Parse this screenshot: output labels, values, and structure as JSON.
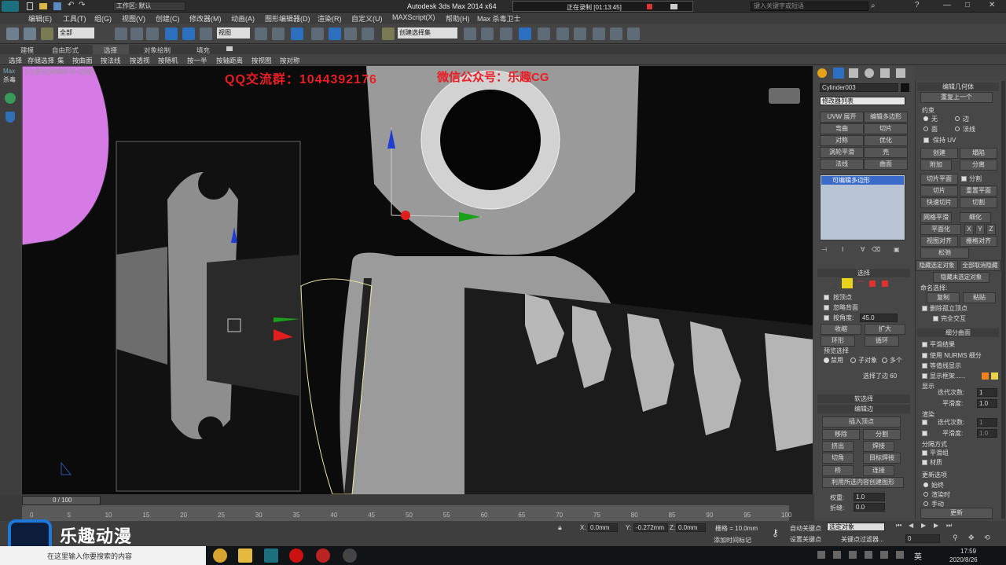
{
  "app": {
    "title": "Autodesk 3ds Max  2014 x64",
    "workspace": "工作区: 默认",
    "search_placeholder": "键入关键字或短语",
    "recording": "正在录制 [01:13:45]"
  },
  "menu": [
    "编辑(E)",
    "工具(T)",
    "组(G)",
    "视图(V)",
    "创建(C)",
    "修改器(M)",
    "动画(A)",
    "图形编辑器(D)",
    "渲染(R)",
    "自定义(U)",
    "MAXScript(X)",
    "帮助(H)",
    "Max 杀毒卫士"
  ],
  "toolbar": {
    "selection_filter": "全部",
    "view_dropdown": "视图",
    "named_set": "创建选择集"
  },
  "ribbon": {
    "tabs": [
      "建模",
      "自由形式",
      "选择",
      "对象绘制",
      "填充"
    ],
    "row": [
      "选择",
      "存储选择",
      "集",
      "按曲面",
      "按法线",
      "按透视",
      "按随机",
      "按一半",
      "按轴距离",
      "按视图",
      "按对称"
    ]
  },
  "leftbar": {
    "max_label": "Max",
    "kill_label": "杀毒"
  },
  "viewport": {
    "label": "[+][透视][明暗处理+边面]",
    "watermark_qq": "QQ交流群：1044392176",
    "watermark_wx": "微信公众号：乐趣CG"
  },
  "cmd": {
    "object_name": "Cylinder003",
    "modifier_list": "修改器列表",
    "mod_buttons": [
      "UVW 展开",
      "编辑多边形",
      "弯曲",
      "切片",
      "对称",
      "优化",
      "涡轮平滑",
      "壳",
      "法线",
      "曲面"
    ],
    "stack_item": "可编辑多边形",
    "selection_header": "选择",
    "sel_opts": [
      "按顶点",
      "忽略背面",
      "按角度:"
    ],
    "angle_val": "45.0",
    "shrink": "收缩",
    "grow": "扩大",
    "ring": "环形",
    "loop": "循环",
    "preview_label": "预览选择",
    "preview_opts": [
      "禁用",
      "子对象",
      "多个"
    ],
    "selected_edges": "选择了边 60",
    "soft_sel": "软选择",
    "edit_edges": "编辑边",
    "insert_vertex": "插入顶点",
    "remove": "移除",
    "split": "分割",
    "extrude": "挤出",
    "weld": "焊接",
    "chamfer": "切角",
    "target_weld": "目标焊接",
    "bridge": "桥",
    "connect": "连接",
    "create_shape": "利用所选内容创建图形",
    "weight": "权重:",
    "crease": "折缝:",
    "weight_val": "1.0",
    "crease_val": "0.0"
  },
  "rollout": {
    "edit_geom": "编辑几何体",
    "repeat": "重复上一个",
    "constraints": "约束",
    "c_opts": [
      "无",
      "边",
      "面",
      "法线"
    ],
    "keep_uv": "保持 UV",
    "create": "创建",
    "collapse": "塌陷",
    "attach": "附加",
    "detach": "分离",
    "slice_plane": "切片平面",
    "split": "分割",
    "slice": "切片",
    "reset_plane": "重置平面",
    "quickslice": "快速切片",
    "cut": "切割",
    "meshsmooth": "网格平滑",
    "tessellate": "细化",
    "planarize": "平面化",
    "x": "X",
    "y": "Y",
    "z": "Z",
    "view_align": "视图对齐",
    "grid_align": "栅格对齐",
    "relax": "松弛",
    "hide_sel": "隐藏选定对象",
    "unhide_all": "全部取消隐藏",
    "hide_unsel": "隐藏未选定对象",
    "named_sel": "命名选择:",
    "copy": "复制",
    "paste": "粘贴",
    "delete_iso": "删除孤立顶点",
    "full_interact": "完全交互",
    "subdiv": "细分曲面",
    "smooth_result": "平滑结果",
    "use_nurms": "使用 NURMS 细分",
    "iso_display": "等值线显示",
    "show_cage": "显示框架......",
    "display": "显示",
    "iterations": "迭代次数:",
    "smoothness": "平滑度:",
    "it_val": "1",
    "sm_val": "1.0",
    "render": "渲染",
    "sep_by": "分隔方式",
    "smooth_groups": "平滑组",
    "materials": "材质",
    "update_opts": "更新选项",
    "always": "始终",
    "when_render": "渲染时",
    "manual": "手动",
    "update": "更新"
  },
  "timeline": {
    "frame": "0 / 100",
    "ticks": [
      "0",
      "5",
      "10",
      "15",
      "20",
      "25",
      "30",
      "35",
      "40",
      "45",
      "50",
      "55",
      "60",
      "65",
      "70",
      "75",
      "80",
      "85",
      "90",
      "95",
      "100"
    ]
  },
  "status": {
    "x": "0.0mm",
    "y": "-0.272mm",
    "z": "0.0mm",
    "grid": "栅格 = 10.0mm",
    "autokey": "自动关键点",
    "selected": "选定对象",
    "setkey": "设置关键点",
    "key_filter": "关键点过滤器...",
    "add_tag": "添加时间标记",
    "frame_val": "0"
  },
  "taskbar": {
    "search": "在这里输入你要搜索的内容",
    "time": "17:59",
    "date": "2020/8/26",
    "lang": "英",
    "logo": "乐趣动漫"
  },
  "colors": {
    "accent": "#1e78d7",
    "cage_orange": "#f0831e",
    "cage_yellow": "#e8d04b"
  }
}
